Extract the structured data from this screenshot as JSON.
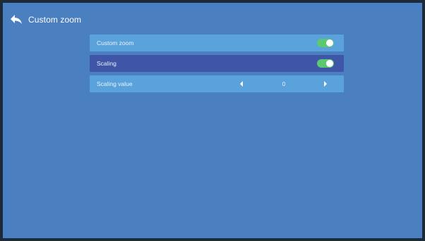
{
  "header": {
    "title": "Custom zoom",
    "back_icon": "back-arrow-icon"
  },
  "menu": {
    "items": [
      {
        "label": "Custom zoom",
        "control": "toggle",
        "on": true,
        "selected": false
      },
      {
        "label": "Scaling",
        "control": "toggle",
        "on": true,
        "selected": true
      },
      {
        "label": "Scaling value",
        "control": "stepper",
        "value": "0",
        "selected": false
      }
    ]
  },
  "colors": {
    "background": "#4a7fc0",
    "row": "#5aa2dc",
    "row_selected": "#3f55a8",
    "toggle_on": "#5cc872"
  }
}
